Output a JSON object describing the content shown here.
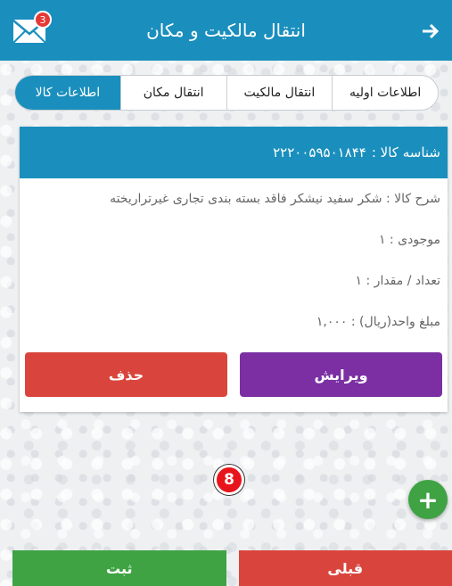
{
  "header": {
    "title": "انتقال مالکیت و مکان",
    "notification_count": "3",
    "back_icon": "arrow-right-icon",
    "mail_icon": "mail-icon"
  },
  "tabs": [
    {
      "label": "اطلاعات اولیه"
    },
    {
      "label": "انتقال مالکیت"
    },
    {
      "label": "انتقال مکان"
    },
    {
      "label": "اطلاعات کالا"
    }
  ],
  "card": {
    "id_label": "شناسه کالا :",
    "id_value": "۲۲۲۰۰۵۹۵۰۱۸۴۴",
    "description": "شرح کالا :  شکر سفید نیشکر  فاقد بسته بندی تجاری غیرتراریخته",
    "stock": "موجودی : ۱",
    "quantity": "تعداد / مقدار : ۱",
    "unit_price": "مبلغ واحد(ریال) : ۱,۰۰۰",
    "edit_label": "ویرایش",
    "delete_label": "حذف"
  },
  "step_number": "8",
  "bottom": {
    "save_label": "ثبت",
    "prev_label": "قبلی"
  },
  "colors": {
    "primary": "#1a8fbd",
    "edit": "#7b2fa3",
    "danger": "#d9453c",
    "success": "#3fa344"
  }
}
